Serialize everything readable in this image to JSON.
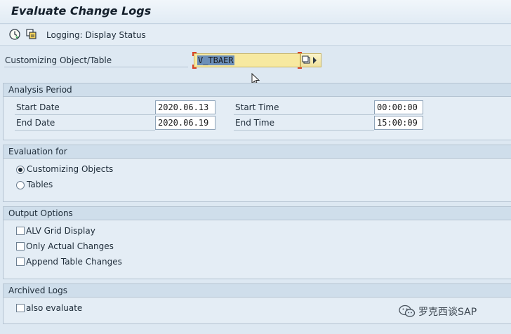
{
  "title": "Evaluate Change Logs",
  "toolbar": {
    "execute_icon": "execute-clock-icon",
    "copy_icon": "copy-icon",
    "logging_label": "Logging: Display Status"
  },
  "object_field": {
    "label": "Customizing Object/Table",
    "value": "V_TBAER"
  },
  "analysis_period": {
    "header": "Analysis Period",
    "start_date_label": "Start Date",
    "start_date": "2020.06.13",
    "end_date_label": "End Date",
    "end_date": "2020.06.19",
    "start_time_label": "Start Time",
    "start_time": "00:00:00",
    "end_time_label": "End Time",
    "end_time": "15:00:09"
  },
  "evaluation": {
    "header": "Evaluation for",
    "options": [
      {
        "label": "Customizing Objects",
        "selected": true
      },
      {
        "label": "Tables",
        "selected": false
      }
    ]
  },
  "output_options": {
    "header": "Output Options",
    "options": [
      {
        "label": "ALV Grid Display",
        "checked": false
      },
      {
        "label": "Only Actual Changes",
        "checked": false
      },
      {
        "label": "Append Table Changes",
        "checked": false
      }
    ]
  },
  "archived_logs": {
    "header": "Archived Logs",
    "options": [
      {
        "label": "also evaluate",
        "checked": false
      }
    ]
  },
  "watermark": {
    "text": "罗克西谈SAP",
    "icon": "wechat-icon"
  }
}
